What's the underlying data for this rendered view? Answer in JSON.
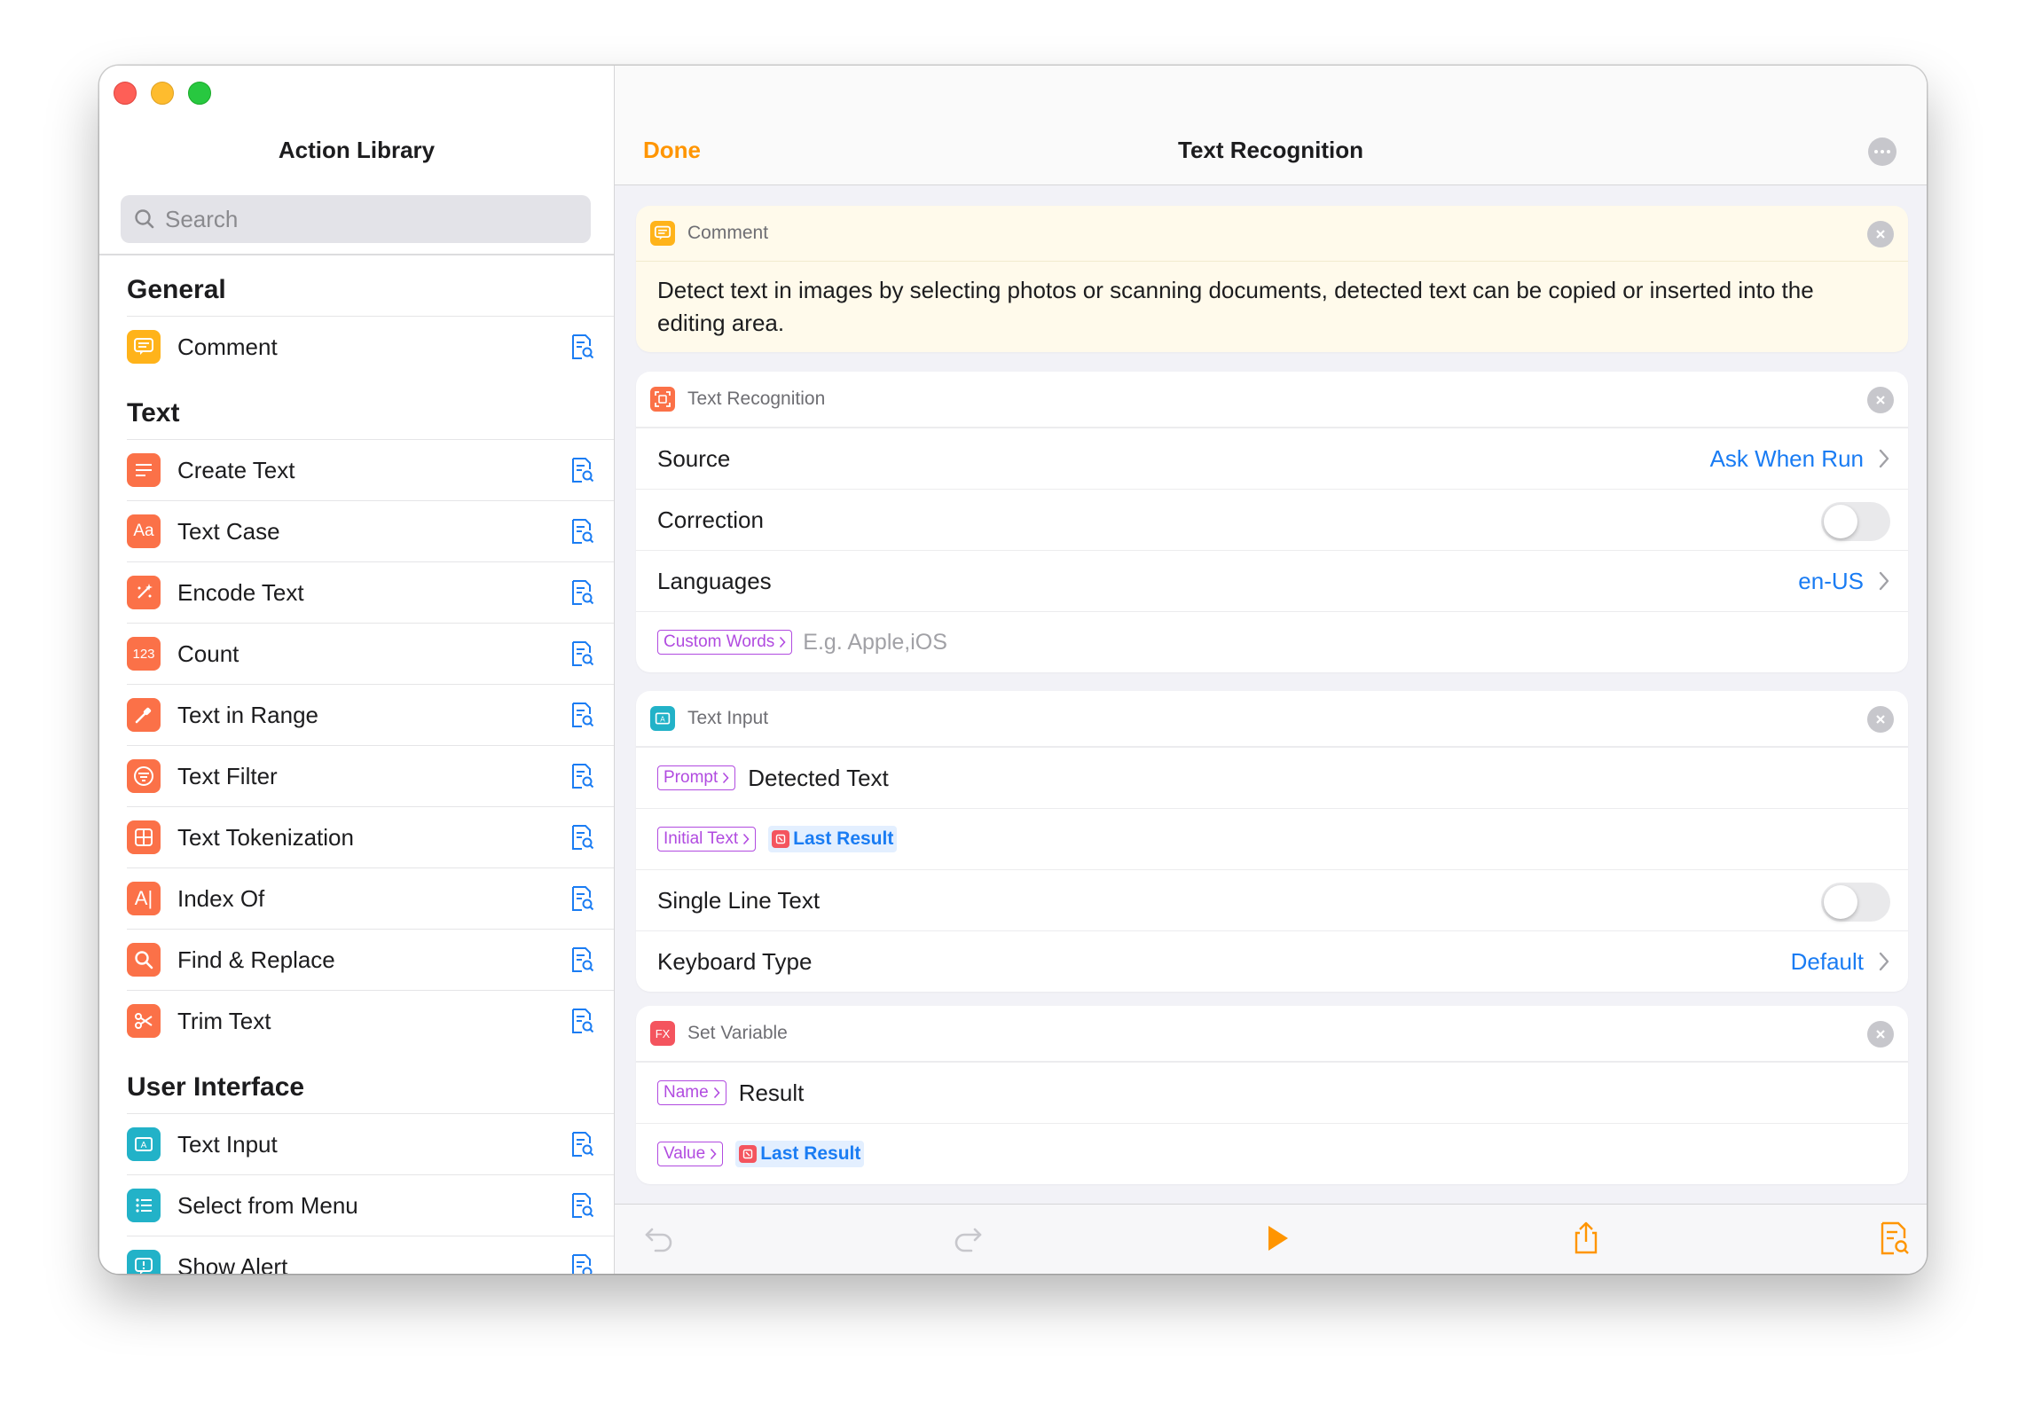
{
  "sidebar": {
    "title": "Action Library",
    "search_placeholder": "Search",
    "sections": [
      {
        "header": "General",
        "items": [
          {
            "label": "Comment",
            "icon": "comment-icon"
          }
        ]
      },
      {
        "header": "Text",
        "items": [
          {
            "label": "Create Text",
            "icon": "text-lines-icon"
          },
          {
            "label": "Text Case",
            "icon": "aa-icon",
            "icon_text": "Aa"
          },
          {
            "label": "Encode Text",
            "icon": "sparkle-icon"
          },
          {
            "label": "Count",
            "icon": "count-icon",
            "icon_text": "123"
          },
          {
            "label": "Text in Range",
            "icon": "dropper-icon"
          },
          {
            "label": "Text Filter",
            "icon": "filter-icon"
          },
          {
            "label": "Text Tokenization",
            "icon": "grid-icon"
          },
          {
            "label": "Index Of",
            "icon": "index-icon",
            "icon_text": "A|"
          },
          {
            "label": "Find & Replace",
            "icon": "magnifier-icon"
          },
          {
            "label": "Trim Text",
            "icon": "scissors-icon"
          }
        ]
      },
      {
        "header": "User Interface",
        "items": [
          {
            "label": "Text Input",
            "icon": "text-input-icon"
          },
          {
            "label": "Select from Menu",
            "icon": "list-icon"
          },
          {
            "label": "Show Alert",
            "icon": "alert-icon"
          }
        ]
      }
    ]
  },
  "main": {
    "done_label": "Done",
    "title": "Text Recognition",
    "comment_card": {
      "title": "Comment",
      "text": "Detect text in images by selecting photos or scanning documents, detected text can be copied or inserted into the editing area."
    },
    "recognition_card": {
      "title": "Text Recognition",
      "source_label": "Source",
      "source_value": "Ask When Run",
      "correction_label": "Correction",
      "correction_on": false,
      "languages_label": "Languages",
      "languages_value": "en-US",
      "custom_words_tag": "Custom Words",
      "custom_words_placeholder": "E.g. Apple,iOS"
    },
    "input_card": {
      "title": "Text Input",
      "prompt_tag": "Prompt",
      "prompt_value": "Detected Text",
      "initial_tag": "Initial Text",
      "initial_value": "Last Result",
      "single_line_label": "Single Line Text",
      "single_line_on": false,
      "keyboard_label": "Keyboard Type",
      "keyboard_value": "Default"
    },
    "variable_card": {
      "title": "Set Variable",
      "icon_text": "FX",
      "name_tag": "Name",
      "name_value": "Result",
      "value_tag": "Value",
      "value_value": "Last Result"
    }
  },
  "colors": {
    "accent_orange": "#ff9500",
    "link_blue": "#1a7cf3",
    "tag_purple": "#b14be0",
    "action_orange": "#fb7148"
  }
}
